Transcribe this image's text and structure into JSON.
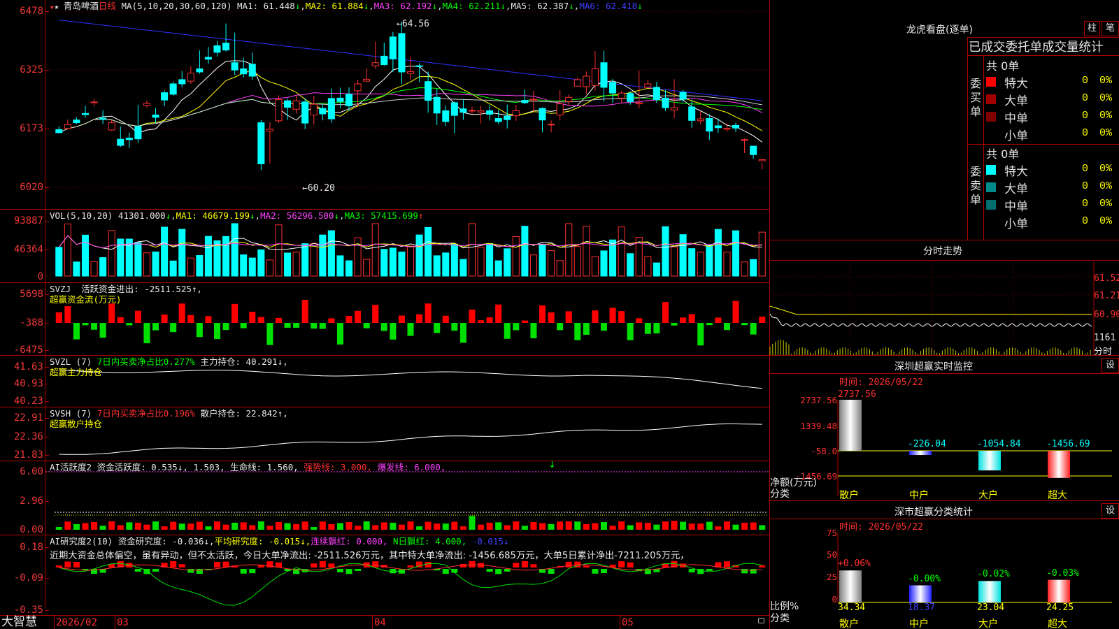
{
  "header": {
    "stock_name": "青岛啤酒",
    "period": "日线",
    "ma_label": "MA(5,10,20,30,60,120)",
    "ma1_label": "MA1:",
    "ma1": "61.448",
    "ma2_label": "MA2:",
    "ma2": "61.884",
    "ma3_label": "MA3:",
    "ma3": "62.192",
    "ma4_label": "MA4:",
    "ma4": "62.211",
    "ma5_label": "MA5:",
    "ma5": "62.387",
    "ma6_label": "MA6:",
    "ma6": "62.418",
    "down_arrow": "↓"
  },
  "price_axis": [
    "6478",
    "6325",
    "6173",
    "6020"
  ],
  "price_annotations": {
    "high": "64.56",
    "low": "60.20",
    "high_arrow": "←",
    "low_arrow": "←"
  },
  "vol_panel": {
    "axis": [
      "93887",
      "46364",
      "0"
    ],
    "label": "VOL(5,10,20)",
    "value": "41301.000",
    "ma1_label": "MA1:",
    "ma1": "46679.199",
    "ma2_label": "MA2:",
    "ma2": "56296.500",
    "ma3_label": "MA3:",
    "ma3": "57415.699",
    "up_arrow": "↑",
    "down_arrow": "↓"
  },
  "svzj_panel": {
    "axis": [
      "5698",
      "-388",
      "-6475"
    ],
    "label": "SVZJ",
    "text1": "活跃资金进出: -2511.525↑,",
    "text2": "超赢资金流(万元)"
  },
  "svzl_panel": {
    "axis": [
      "41.63",
      "40.93",
      "40.23"
    ],
    "label": "SVZL (7)",
    "text1": "7日内买卖净占比0.277%",
    "text2": "主力持仓: 40.291↓,",
    "text3": "超赢主力持仓"
  },
  "svsh_panel": {
    "axis": [
      "22.91",
      "22.36",
      "21.83"
    ],
    "label": "SVSH (7)",
    "text1": "7日内买卖净占比0.196%",
    "text2": "散户持仓: 22.842↑,",
    "text3": "超赢散户持仓"
  },
  "ai_active_panel": {
    "axis": [
      "6.00",
      "2.96",
      "0.00"
    ],
    "label": "AI活跃度2",
    "text1": "资金活跃度: 0.535↓,",
    "text2": "1.503,",
    "text3": "生命线: 1.560,",
    "text4": "强势线: 3.000,",
    "text5": "爆发线: 6.000,",
    "arrow": "↓"
  },
  "ai_research_panel": {
    "axis": [
      "0.18",
      "-0.09",
      "-0.35"
    ],
    "label": "AI研究度2(10)",
    "text1": "资金研究度: -0.036↓,",
    "text2": "平均研究度: -0.015↓,",
    "text3": "连续飘红: 0.000,",
    "text4": "N日飘红: 4.000,",
    "text5": "-0.015↓",
    "comment": "近期大资金总体偏空，虽有异动，但不太活跃，今日大单净流出: -2511.526万元，其中特大单净流出: -1456.685万元，大单5日累计净出-7211.205万元，"
  },
  "date_axis": {
    "brand": "大智慧",
    "d0": "2026/02",
    "d1": "03",
    "d2": "04",
    "d3": "05"
  },
  "longhu": {
    "title": "龙虎看盘(逐单)",
    "btn_zhu": "柱",
    "btn_bi": "笔",
    "subtitle": "已成交委托单成交量统计",
    "buy_label": "委买单",
    "sell_label": "委卖单",
    "buy_total": "共 0单",
    "sell_total": "共 0单",
    "buy_rows": [
      {
        "name": "特大",
        "count": "0",
        "pct": "0%"
      },
      {
        "name": "大单",
        "count": "0",
        "pct": "0%"
      },
      {
        "name": "中单",
        "count": "0",
        "pct": "0%"
      },
      {
        "name": "小单",
        "count": "0",
        "pct": "0%"
      }
    ],
    "sell_rows": [
      {
        "name": "特大",
        "count": "0",
        "pct": "0%"
      },
      {
        "name": "大单",
        "count": "0",
        "pct": "0%"
      },
      {
        "name": "中单",
        "count": "0",
        "pct": "0%"
      },
      {
        "name": "小单",
        "count": "0",
        "pct": "0%"
      }
    ],
    "buy_colors": [
      "#ff0000",
      "#a00000",
      "#800000",
      "#000000"
    ],
    "sell_colors": [
      "#00ffff",
      "#008c8c",
      "#006e6e",
      "#000000"
    ]
  },
  "intraday": {
    "title": "分时走势",
    "axis": [
      "61.52",
      "61.21",
      "60.90",
      "1161"
    ],
    "footer": "分时"
  },
  "sz_monitor": {
    "title": "深圳超赢实时监控",
    "btn": "设",
    "date_label": "时间: 2026/05/22",
    "axis": [
      "2737.56",
      "1339.48",
      "-58.0",
      "-1456.69"
    ],
    "unit": "净额(万元)",
    "unit2": "分类",
    "bars": [
      {
        "name": "散户",
        "value": "2737.56"
      },
      {
        "name": "中户",
        "value": "-226.04"
      },
      {
        "name": "大户",
        "value": "-1054.84"
      },
      {
        "name": "超大",
        "value": "-1456.69"
      }
    ]
  },
  "sz_stats": {
    "title": "深市超赢分类统计",
    "btn": "设",
    "date_label": "时间: 2026/05/22",
    "axis": [
      "75",
      "50",
      "25",
      "0"
    ],
    "unit": "比例%",
    "unit2": "分类",
    "bars": [
      {
        "name": "散户",
        "ratio": "34.34",
        "change": "+0.06%"
      },
      {
        "name": "中户",
        "ratio": "18.37",
        "change": "-0.00%"
      },
      {
        "name": "大户",
        "ratio": "23.04",
        "change": "-0.02%"
      },
      {
        "name": "超大",
        "ratio": "24.25",
        "change": "-0.03%"
      }
    ]
  },
  "chart_data": {
    "type": "candlestick",
    "ylim": [
      60.2,
      64.78
    ],
    "candles": [
      [
        61.7,
        61.62,
        61.79,
        61.6
      ],
      [
        61.73,
        61.83,
        61.96,
        61.7
      ],
      [
        61.95,
        61.88,
        62.02,
        61.85
      ],
      [
        62.12,
        62.09,
        62.32,
        62.01
      ],
      [
        62.4,
        62.42,
        62.5,
        62.3
      ],
      [
        62.0,
        61.97,
        62.2,
        61.85
      ],
      [
        61.69,
        61.88,
        61.95,
        61.67
      ],
      [
        61.45,
        61.29,
        61.78,
        61.25
      ],
      [
        61.48,
        61.44,
        61.62,
        61.22
      ],
      [
        61.78,
        61.46,
        62.35,
        61.36
      ],
      [
        62.33,
        62.38,
        62.46,
        62.27
      ],
      [
        62.08,
        62.02,
        62.26,
        61.87
      ],
      [
        62.66,
        62.47,
        62.72,
        62.31
      ],
      [
        62.89,
        62.62,
        62.95,
        62.58
      ],
      [
        63.0,
        62.89,
        63.22,
        62.8
      ],
      [
        62.96,
        63.17,
        63.35,
        62.89
      ],
      [
        63.28,
        63.2,
        63.76,
        63.15
      ],
      [
        63.58,
        63.53,
        63.85,
        63.41
      ],
      [
        63.88,
        63.71,
        64.0,
        63.6
      ],
      [
        63.95,
        63.77,
        64.46,
        63.73
      ],
      [
        63.44,
        63.25,
        64.22,
        63.12
      ],
      [
        63.28,
        63.15,
        63.57,
        63.06
      ],
      [
        63.4,
        63.09,
        63.7,
        62.99
      ],
      [
        61.88,
        60.81,
        61.95,
        60.65
      ],
      [
        61.66,
        61.71,
        61.89,
        60.82
      ],
      [
        61.93,
        62.48,
        62.59,
        61.87
      ],
      [
        62.45,
        62.28,
        62.5,
        61.95
      ],
      [
        62.23,
        62.45,
        62.58,
        62.12
      ],
      [
        62.42,
        61.87,
        62.52,
        61.71
      ],
      [
        62.08,
        62.36,
        62.58,
        61.83
      ],
      [
        62.25,
        62.11,
        62.37,
        61.94
      ],
      [
        62.51,
        61.98,
        62.77,
        61.88
      ],
      [
        62.52,
        62.43,
        62.79,
        62.26
      ],
      [
        62.62,
        62.32,
        62.8,
        62.19
      ],
      [
        62.71,
        62.89,
        63.0,
        62.29
      ],
      [
        62.96,
        63.01,
        63.29,
        62.94
      ],
      [
        63.36,
        63.44,
        63.99,
        63.29
      ],
      [
        63.61,
        63.39,
        63.96,
        63.36
      ],
      [
        64.11,
        63.54,
        64.24,
        63.2
      ],
      [
        64.2,
        63.2,
        64.5,
        62.88
      ],
      [
        63.16,
        63.21,
        63.59,
        62.99
      ],
      [
        63.36,
        63.34,
        63.43,
        62.93
      ],
      [
        62.95,
        62.46,
        63.21,
        62.14
      ],
      [
        62.54,
        62.13,
        62.76,
        61.82
      ],
      [
        62.19,
        61.91,
        62.33,
        61.79
      ],
      [
        62.4,
        62.07,
        62.44,
        61.61
      ],
      [
        62.24,
        62.15,
        62.49,
        61.96
      ],
      [
        62.2,
        62.2,
        62.3,
        62.11
      ],
      [
        62.16,
        62.19,
        62.33,
        61.86
      ],
      [
        62.19,
        62.1,
        62.35,
        61.94
      ],
      [
        61.99,
        61.91,
        62.21,
        61.84
      ],
      [
        62.05,
        61.96,
        62.35,
        61.73
      ],
      [
        62.06,
        62.19,
        62.34,
        61.93
      ],
      [
        62.46,
        62.4,
        62.74,
        62.36
      ],
      [
        62.47,
        62.49,
        62.71,
        62.17
      ],
      [
        62.25,
        61.95,
        62.28,
        61.63
      ],
      [
        61.84,
        61.84,
        61.94,
        61.63
      ],
      [
        62.08,
        62.37,
        62.73,
        61.94
      ],
      [
        62.43,
        62.54,
        62.61,
        62.33
      ],
      [
        62.83,
        63.0,
        63.05,
        62.82
      ],
      [
        62.82,
        63.09,
        63.21,
        62.62
      ],
      [
        62.85,
        63.28,
        63.74,
        62.72
      ],
      [
        63.44,
        62.8,
        63.75,
        62.43
      ],
      [
        62.93,
        62.65,
        63.02,
        62.4
      ],
      [
        62.52,
        62.65,
        62.7,
        62.39
      ],
      [
        62.64,
        62.43,
        62.7,
        62.35
      ],
      [
        62.37,
        62.4,
        63.23,
        62.25
      ],
      [
        62.8,
        62.89,
        63.0,
        62.77
      ],
      [
        62.8,
        62.48,
        62.94,
        62.39
      ],
      [
        62.52,
        62.27,
        62.73,
        62.18
      ],
      [
        62.21,
        62.27,
        63.01,
        62.0
      ],
      [
        62.67,
        62.49,
        62.73,
        62.41
      ],
      [
        62.29,
        61.94,
        62.48,
        61.75
      ],
      [
        61.93,
        61.98,
        62.18,
        61.84
      ],
      [
        61.99,
        61.66,
        62.1,
        61.43
      ],
      [
        61.8,
        61.75,
        61.99,
        61.61
      ],
      [
        61.72,
        61.73,
        61.86,
        61.64
      ],
      [
        61.81,
        61.74,
        61.88,
        61.64
      ],
      [
        61.44,
        61.44,
        61.47,
        61.09
      ],
      [
        61.27,
        61.05,
        61.17,
        60.94
      ],
      [
        60.89,
        60.92,
        60.84,
        60.67
      ]
    ]
  }
}
